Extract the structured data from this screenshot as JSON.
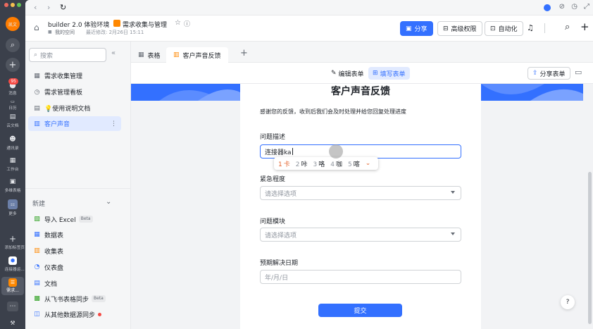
{
  "rail": {
    "avatar": "凯文",
    "items": [
      {
        "icon": "search-icon",
        "label": ""
      },
      {
        "icon": "plus-icon",
        "label": ""
      },
      {
        "icon": "chat-icon",
        "label": "消息",
        "badge": "95"
      },
      {
        "icon": "calendar-icon",
        "label": "日历"
      },
      {
        "icon": "cloud-doc-icon",
        "label": "云文档"
      },
      {
        "icon": "contacts-icon",
        "label": "通讯录"
      },
      {
        "icon": "workplace-icon",
        "label": "工作台"
      },
      {
        "icon": "bitable-icon",
        "label": "多维表格"
      },
      {
        "icon": "more-icon",
        "label": "更多"
      },
      {
        "icon": "add-tab-icon",
        "label": "添加标签页"
      },
      {
        "icon": "connector-icon",
        "label": "连接器运..."
      },
      {
        "icon": "demand-icon",
        "label": "需求..."
      },
      {
        "icon": "ellipsis-icon",
        "label": ""
      }
    ]
  },
  "topbar": {
    "back": "‹",
    "forward": "›",
    "refresh": "↻"
  },
  "header": {
    "workspace_title": "builder 2.0 体验环境",
    "breadcrumb_sep": "›",
    "doc_title": "需求收集与管理",
    "my_space": "我的空间",
    "last_modified": "最近修改: 2月26日 15:11",
    "share_label": "分享",
    "advanced_perm_label": "高级权限",
    "automation_label": "自动化"
  },
  "sidebar": {
    "search_placeholder": "搜索",
    "collapse": "«",
    "items": [
      {
        "icon": "grid-icon",
        "label": "需求收集管理"
      },
      {
        "icon": "clock-icon",
        "label": "需求管理看板"
      },
      {
        "icon": "doc-icon",
        "label": "💡使用说明文档"
      },
      {
        "icon": "form-icon",
        "label": "客户声音",
        "active": true
      }
    ],
    "new_section_label": "新建",
    "new_items": [
      {
        "icon": "excel-icon",
        "label": "导入 Excel",
        "beta": "Beta",
        "color": "#2ea121"
      },
      {
        "icon": "table-icon",
        "label": "数据表",
        "color": "#3370ff"
      },
      {
        "icon": "form-icon",
        "label": "收集表",
        "color": "#ff8800"
      },
      {
        "icon": "dashboard-icon",
        "label": "仪表盘",
        "color": "#3370ff"
      },
      {
        "icon": "doc-icon",
        "label": "文档",
        "color": "#3370ff"
      },
      {
        "icon": "sync-icon",
        "label": "从飞书表格同步",
        "beta": "Beta",
        "color": "#2ea121"
      },
      {
        "icon": "datasource-icon",
        "label": "从其他数据源同步",
        "dot": true,
        "color": "#3370ff"
      }
    ]
  },
  "tabs": [
    {
      "icon": "table-icon",
      "label": "表格"
    },
    {
      "icon": "form-icon",
      "label": "客户声音反馈",
      "active": true
    }
  ],
  "tab_add": "+",
  "formbar": {
    "edit_label": "编辑表单",
    "fill_label": "填写表单",
    "share_form_label": "分享表单"
  },
  "form": {
    "title": "客户声音反馈",
    "description": "感谢您的反馈，收到后我们会及时处理并给您回复处理进度",
    "fields": [
      {
        "label": "问题描述",
        "value": "连接器ka",
        "type": "text"
      },
      {
        "label": "紧急程度",
        "placeholder": "请选择选项",
        "type": "select"
      },
      {
        "label": "问题模块",
        "placeholder": "请选择选项",
        "type": "select"
      },
      {
        "label": "预期解决日期",
        "placeholder": "年/月/日",
        "type": "date"
      }
    ],
    "submit_label": "提交",
    "ime_candidates": [
      {
        "num": "1",
        "text": "卡",
        "selected": true
      },
      {
        "num": "2",
        "text": "咔"
      },
      {
        "num": "3",
        "text": "咯"
      },
      {
        "num": "4",
        "text": "咖"
      },
      {
        "num": "5",
        "text": "喀"
      }
    ],
    "ime_more": "⌄"
  },
  "help_label": "?",
  "colors": {
    "accent": "#3370ff",
    "active_bg": "#e1eaff",
    "rail_bg": "#3b404b"
  }
}
